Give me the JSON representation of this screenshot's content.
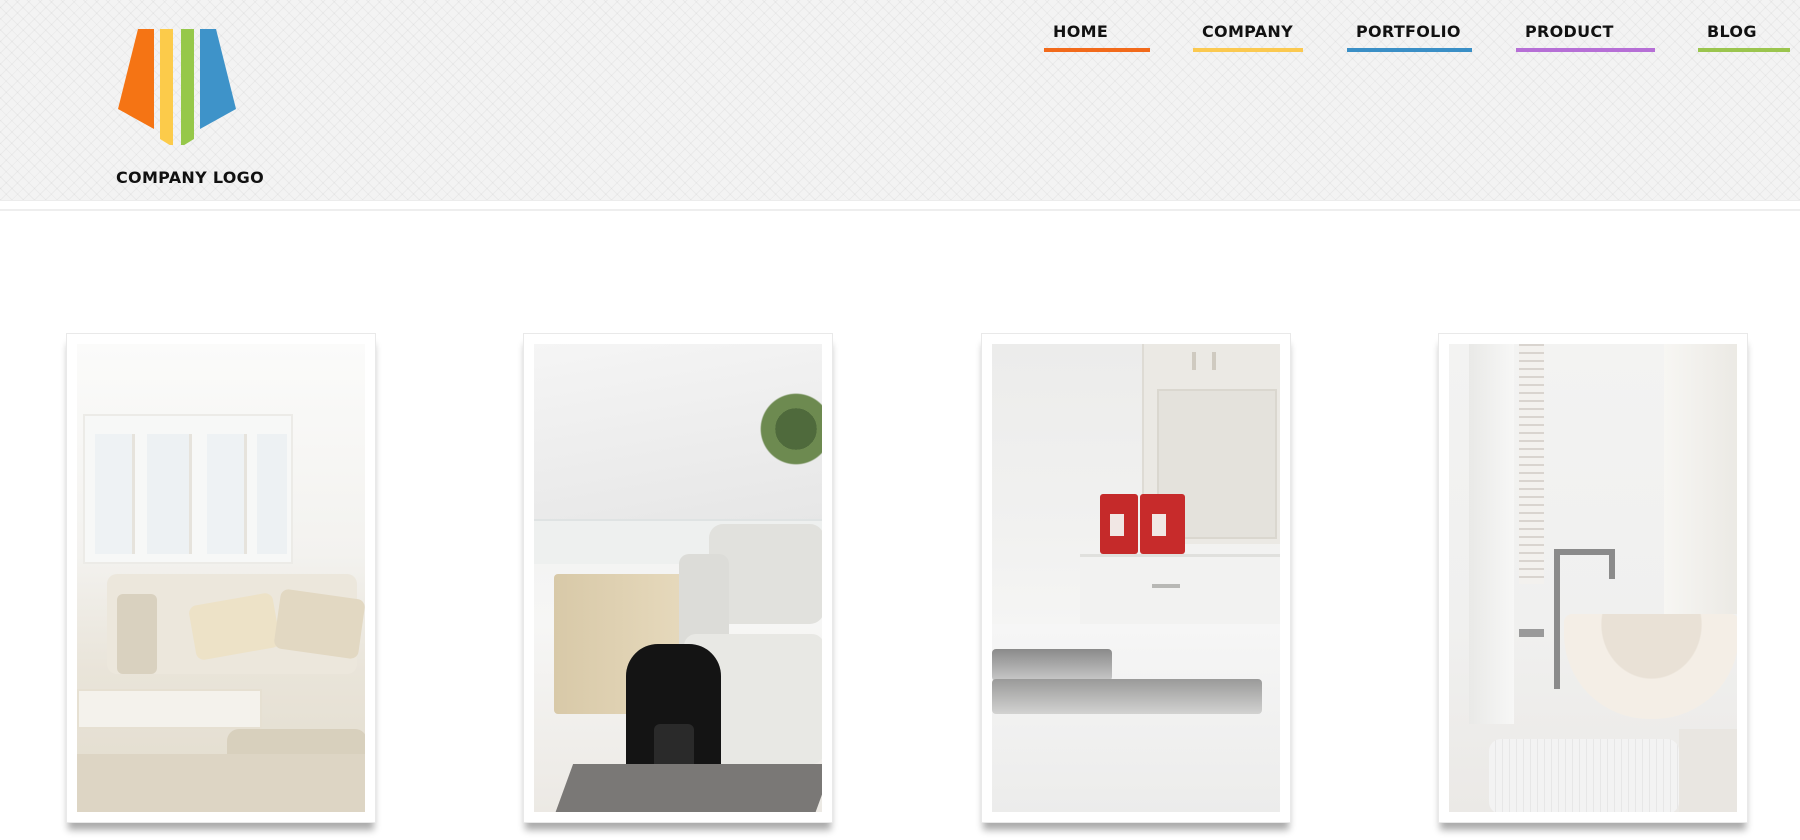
{
  "logo": {
    "text": "COMPANY LOGO",
    "stripe_colors": [
      "#f57414",
      "#fccb4a",
      "#96c84a",
      "#3e93c9"
    ]
  },
  "nav": {
    "items": [
      {
        "label": "HOME",
        "color": "#f26a1b"
      },
      {
        "label": "COMPANY",
        "color": "#fbc950"
      },
      {
        "label": "PORTFOLIO",
        "color": "#3a8fc6"
      },
      {
        "label": "PRODUCT",
        "color": "#b66fd6"
      },
      {
        "label": "BLOG",
        "color": "#9bc54e"
      }
    ]
  },
  "gallery": {
    "items": [
      {
        "subject": "living-room"
      },
      {
        "subject": "lounge-chair-with-backpack"
      },
      {
        "subject": "kitchen-sink"
      },
      {
        "subject": "bathroom-basin"
      }
    ]
  }
}
